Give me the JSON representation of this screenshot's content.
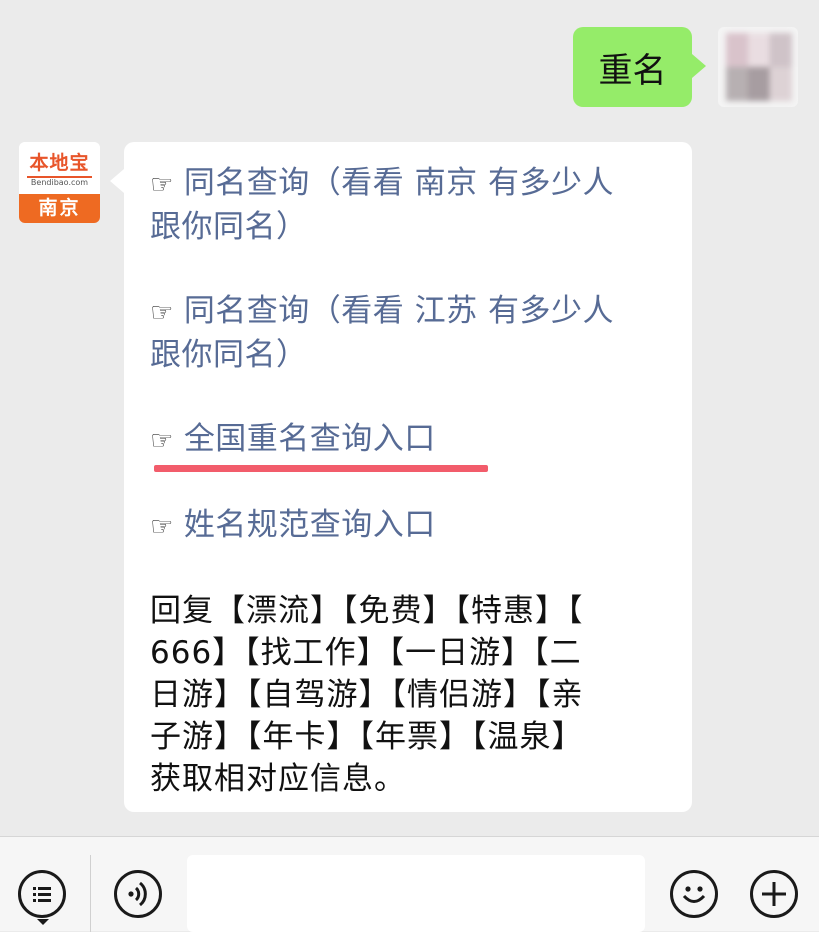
{
  "outgoing": {
    "text": "重名"
  },
  "bot": {
    "logo_name": "本地宝",
    "logo_url": "Bendibao.com",
    "logo_city": "南京"
  },
  "incoming": {
    "links": [
      {
        "icon": "☞",
        "text": "同名查询（看看 南京 有多少人跟你同名）",
        "line1": "同名查询（看看 南京 有多少人",
        "line2": "跟你同名）"
      },
      {
        "icon": "☞",
        "text": "同名查询（看看 江苏 有多少人跟你同名）",
        "line1": "同名查询（看看 江苏 有多少人",
        "line2": "跟你同名）"
      },
      {
        "icon": "☞",
        "text": "全国重名查询入口",
        "highlighted": true
      },
      {
        "icon": "☞",
        "text": "姓名规范查询入口"
      }
    ],
    "reply_lines": [
      "回复【漂流】【免费】【特惠】【",
      "666】【找工作】【一日游】【二",
      "日游】【自驾游】【情侣游】【亲",
      "子游】【年卡】【年票】【温泉】",
      "获取相对应信息。"
    ]
  },
  "input_bar": {
    "menu_icon": "menu-list-icon",
    "voice_icon": "voice-icon",
    "emoji_icon": "emoji-icon",
    "plus_icon": "plus-icon"
  },
  "colors": {
    "outgoing_bubble": "#95ec69",
    "link_text": "#576b95",
    "highlight_underline": "#f25c6b",
    "background": "#ebebeb"
  }
}
